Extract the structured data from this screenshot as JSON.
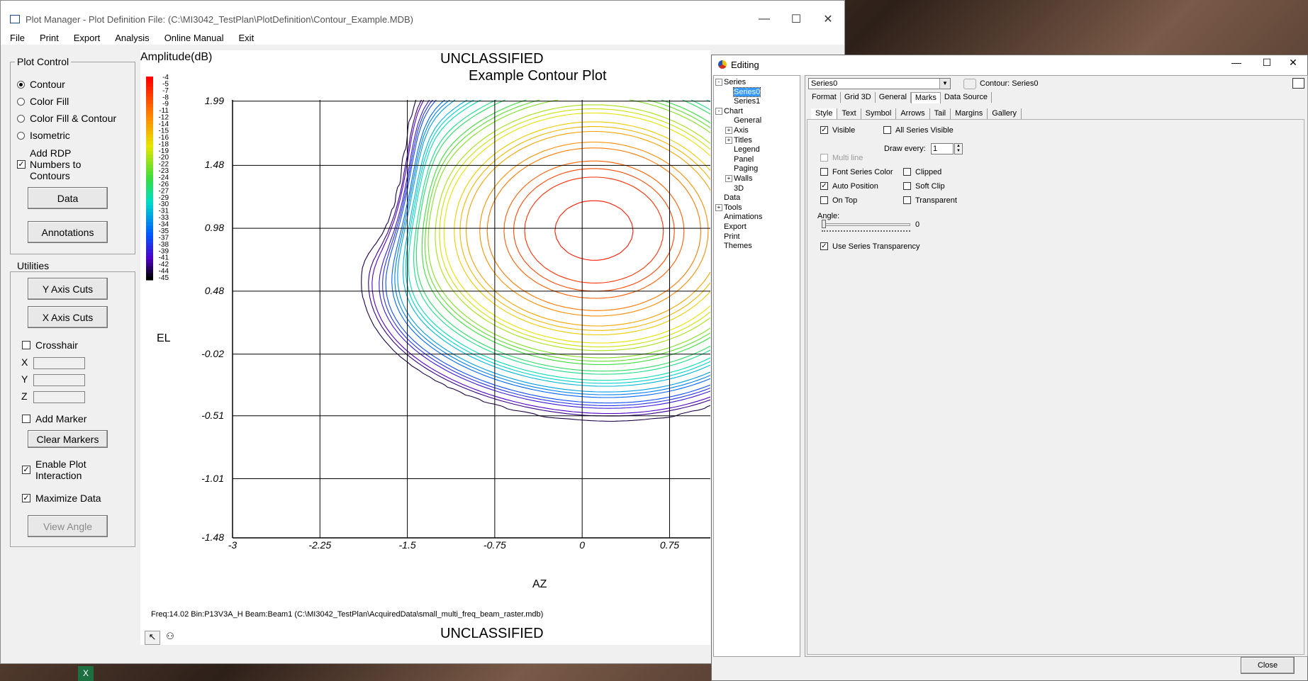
{
  "main_window": {
    "title": "Plot Manager - Plot Definition File: (C:\\MI3042_TestPlan\\PlotDefinition\\Contour_Example.MDB)",
    "menu": [
      "File",
      "Print",
      "Export",
      "Analysis",
      "Online Manual",
      "Exit"
    ]
  },
  "plot_control": {
    "title": "Plot Control",
    "options": [
      {
        "label": "Contour",
        "selected": true
      },
      {
        "label": "Color Fill",
        "selected": false
      },
      {
        "label": "Color Fill & Contour",
        "selected": false
      },
      {
        "label": "Isometric",
        "selected": false
      }
    ],
    "rdp_label_1": "Add RDP",
    "rdp_label_2": "Numbers to",
    "rdp_label_3": "Contours",
    "data_button": "Data",
    "annotations_button": "Annotations"
  },
  "utilities": {
    "title": "Utilities",
    "y_axis_cuts": "Y Axis Cuts",
    "x_axis_cuts": "X Axis Cuts",
    "crosshair": "Crosshair",
    "x_label": "X",
    "y_label": "Y",
    "z_label": "Z",
    "add_marker": "Add Marker",
    "clear_markers": "Clear Markers",
    "enable_1": "Enable Plot",
    "enable_2": "Interaction",
    "maximize": "Maximize Data",
    "view_angle": "View Angle"
  },
  "chart_data": {
    "type": "contour",
    "title_top": "UNCLASSIFIED",
    "title": "Example Contour Plot",
    "legend_title": "Amplitude(dB)",
    "legend_values": [
      "-4",
      "-5",
      "-7",
      "-8",
      "-9",
      "-11",
      "-12",
      "-14",
      "-15",
      "-16",
      "-18",
      "-19",
      "-20",
      "-22",
      "-23",
      "-24",
      "-26",
      "-27",
      "-29",
      "-30",
      "-31",
      "-33",
      "-34",
      "-35",
      "-37",
      "-38",
      "-39",
      "-41",
      "-42",
      "-44",
      "-45"
    ],
    "ylabel": "EL",
    "xlabel": "AZ",
    "y_ticks": [
      "1.99",
      "1.48",
      "0.98",
      "0.48",
      "-0.02",
      "-0.51",
      "-1.01",
      "-1.48"
    ],
    "x_ticks": [
      "-3",
      "-2.25",
      "-1.5",
      "-0.75",
      "0",
      "0.75"
    ],
    "xlim": [
      -3,
      1.1
    ],
    "ylim": [
      -1.48,
      2.0
    ],
    "footer": "Freq:14.02  Bin:P13V3A_H  Beam:Beam1  (C:\\MI3042_TestPlan\\AcquiredData\\small_multi_freq_beam_raster.mdb)",
    "title_bottom": "UNCLASSIFIED"
  },
  "editing": {
    "title": "Editing",
    "tree": [
      {
        "label": "Series",
        "expander": "-"
      },
      {
        "label": "Series0",
        "selected": true
      },
      {
        "label": "Series1"
      },
      {
        "label": "Chart",
        "expander": "-"
      },
      {
        "label": "General"
      },
      {
        "label": "Axis",
        "expander": "+"
      },
      {
        "label": "Titles",
        "expander": "+"
      },
      {
        "label": "Legend"
      },
      {
        "label": "Panel"
      },
      {
        "label": "Paging"
      },
      {
        "label": "Walls",
        "expander": "+"
      },
      {
        "label": "3D"
      },
      {
        "label": "Data"
      },
      {
        "label": "Tools",
        "expander": "+"
      },
      {
        "label": "Animations"
      },
      {
        "label": "Export"
      },
      {
        "label": "Print"
      },
      {
        "label": "Themes"
      }
    ],
    "series_select": "Series0",
    "series_caption": "Contour: Series0",
    "tabs_top": [
      "Format",
      "Grid 3D",
      "General",
      "Marks",
      "Data Source"
    ],
    "tabs_sub": [
      "Style",
      "Text",
      "Symbol",
      "Arrows",
      "Tail",
      "Margins",
      "Gallery"
    ],
    "visible": "Visible",
    "all_series_visible": "All Series Visible",
    "draw_every": "Draw every:",
    "draw_every_value": "1",
    "multi_line": "Multi line",
    "font_series_color": "Font Series Color",
    "clipped": "Clipped",
    "auto_position": "Auto Position",
    "soft_clip": "Soft Clip",
    "on_top": "On Top",
    "transparent": "Transparent",
    "angle": "Angle:",
    "angle_value": "0",
    "use_series_transparency": "Use Series Transparency",
    "close_button": "Close"
  }
}
